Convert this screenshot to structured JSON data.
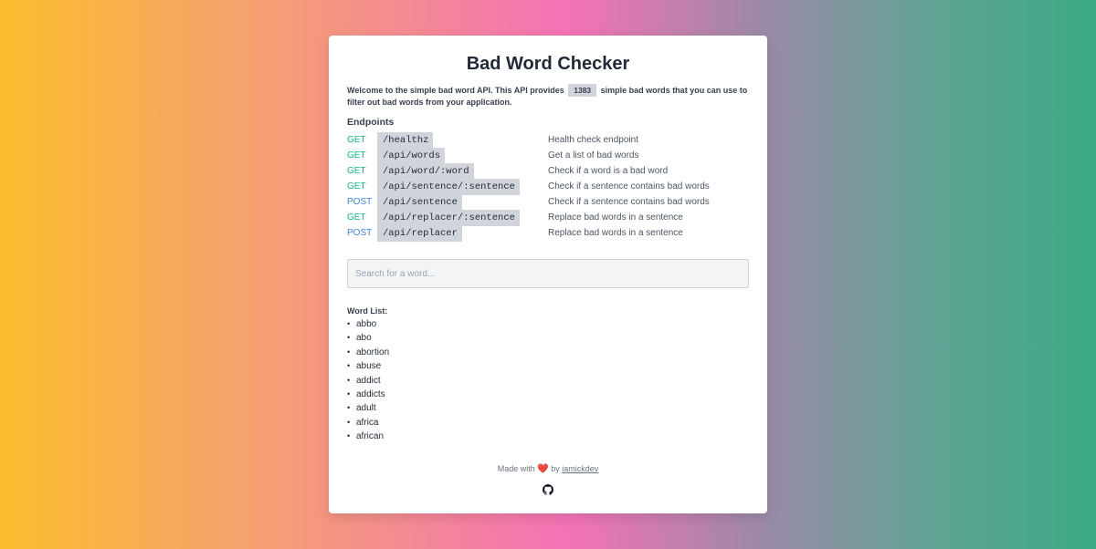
{
  "title": "Bad Word Checker",
  "intro": {
    "before": "Welcome to the simple bad word API. This API provides",
    "count": "1383",
    "after": "simple bad words that you can use to filter out bad words from your application."
  },
  "endpoints": {
    "heading": "Endpoints",
    "items": [
      {
        "method": "GET",
        "path": "/healthz",
        "desc": "Health check endpoint"
      },
      {
        "method": "GET",
        "path": "/api/words",
        "desc": "Get a list of bad words"
      },
      {
        "method": "GET",
        "path": "/api/word/:word",
        "desc": "Check if a word is a bad word"
      },
      {
        "method": "GET",
        "path": "/api/sentence/:sentence",
        "desc": "Check if a sentence contains bad words"
      },
      {
        "method": "POST",
        "path": "/api/sentence",
        "desc": "Check if a sentence contains bad words"
      },
      {
        "method": "GET",
        "path": "/api/replacer/:sentence",
        "desc": "Replace bad words in a sentence"
      },
      {
        "method": "POST",
        "path": "/api/replacer",
        "desc": "Replace bad words in a sentence"
      }
    ],
    "colors": {
      "GET": "#10b981",
      "POST": "#3b82f6"
    }
  },
  "search": {
    "placeholder": "Search for a word...",
    "value": ""
  },
  "wordlist": {
    "label": "Word List:",
    "bullet": "•",
    "words": [
      "abbo",
      "abo",
      "abortion",
      "abuse",
      "addict",
      "addicts",
      "adult",
      "africa",
      "african"
    ]
  },
  "footer": {
    "made_with": "Made with",
    "heart": "❤️",
    "by": "by",
    "author": "iamickdev",
    "github_icon": "github-icon"
  }
}
